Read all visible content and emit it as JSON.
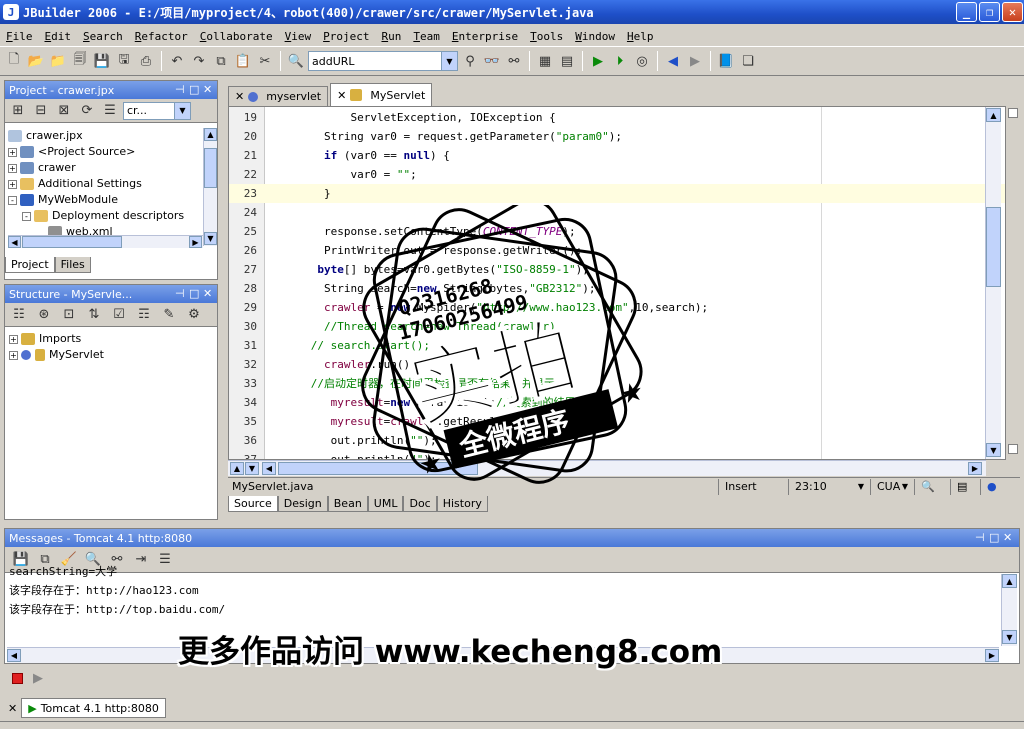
{
  "window": {
    "title": "JBuilder 2006 - E:/项目/myproject/4、robot(400)/crawer/src/crawer/MyServlet.java",
    "minimize_glyph": "_",
    "restore_glyph": "❐",
    "close_glyph": "✕"
  },
  "menu": [
    "File",
    "Edit",
    "Search",
    "Refactor",
    "Collaborate",
    "View",
    "Project",
    "Run",
    "Team",
    "Enterprise",
    "Tools",
    "Window",
    "Help"
  ],
  "toolbar": {
    "target_combo": "addURL"
  },
  "project_panel": {
    "title": "Project - crawer.jpx",
    "combo": "cr...",
    "tree": [
      {
        "label": "crawer.jpx",
        "indent": 0,
        "expander": "",
        "icon": "project-icon"
      },
      {
        "label": "<Project Source>",
        "indent": 1,
        "expander": "+",
        "icon": "package-icon"
      },
      {
        "label": "crawer",
        "indent": 1,
        "expander": "+",
        "icon": "package-icon"
      },
      {
        "label": "Additional Settings",
        "indent": 1,
        "expander": "+",
        "icon": "folder-icon"
      },
      {
        "label": "MyWebModule",
        "indent": 1,
        "expander": "-",
        "icon": "module-icon"
      },
      {
        "label": "Deployment descriptors",
        "indent": 2,
        "expander": "-",
        "icon": "folder-icon"
      },
      {
        "label": "web.xml",
        "indent": 3,
        "expander": "",
        "icon": "xml-icon"
      }
    ],
    "tabs": [
      "Project",
      "Files"
    ]
  },
  "structure_panel": {
    "title": "Structure - MyServle...",
    "tree": [
      {
        "label": "Imports",
        "expander": "+",
        "icon": "imports-icon"
      },
      {
        "label": "MyServlet",
        "expander": "+",
        "icon": "class-icon"
      }
    ]
  },
  "editor": {
    "tabs": [
      {
        "label": "myservlet",
        "active": false
      },
      {
        "label": "MyServlet",
        "active": true
      }
    ],
    "lines": [
      {
        "n": "19",
        "html": "            ServletException, IOException {",
        "hl": false
      },
      {
        "n": "20",
        "html": "        String var0 = request.getParameter(<span class='str'>\"param0\"</span>);",
        "hl": false
      },
      {
        "n": "21",
        "html": "        <span class='kw'>if</span> (var0 == <span class='kw'>null</span>) {",
        "hl": false
      },
      {
        "n": "22",
        "html": "            var0 = <span class='str'>\"\"</span>;",
        "hl": false
      },
      {
        "n": "23",
        "html": "        }",
        "hl": true
      },
      {
        "n": "24",
        "html": "",
        "hl": false
      },
      {
        "n": "25",
        "html": "        response.setContentType(<span class='cst'>CONTENT_TYPE</span>);",
        "hl": false
      },
      {
        "n": "26",
        "html": "        PrintWriter out = response.getWriter();",
        "hl": false
      },
      {
        "n": "27",
        "html": "       <span class='kw'>byte</span>[] bytes=var0.getBytes(<span class='str'>\"ISO-8859-1\"</span>);",
        "hl": false
      },
      {
        "n": "28",
        "html": "        String search=<span class='kw'>new</span> String(bytes,<span class='str'>\"GB2312\"</span>);",
        "hl": false
      },
      {
        "n": "29",
        "html": "        <span class='field'>crawler</span> = <span class='kw'>new</span> Myspider(<span class='str'>\"http://www.hao123.com\"</span>,10,search);",
        "hl": false
      },
      {
        "n": "30",
        "html": "        <span class='cmt'>//Thread search=new Thread(crawler)</span>",
        "hl": false
      },
      {
        "n": "31",
        "html": "      <span class='cmt'>// search.start();</span>",
        "hl": false
      },
      {
        "n": "32",
        "html": "        <span class='field'>crawler</span>.run();",
        "hl": false
      },
      {
        "n": "33",
        "html": "      <span class='cmt'>//启动定时器，在时间里检查是否有结果，并显示</span>",
        "hl": false
      },
      {
        "n": "34",
        "html": "         <span class='field'>myresult</span>=<span class='kw'>new</span> ArrayList<String>();<span class='cmt'>//搜索到的结果</span>",
        "hl": false
      },
      {
        "n": "35",
        "html": "         <span class='field'>myresult</span>=<span class='field'>crawler</span>.getResult();",
        "hl": false
      },
      {
        "n": "36",
        "html": "         out.println(<span class='str'>\"<html>\"</span>);",
        "hl": false
      },
      {
        "n": "37",
        "html": "         out.println(<span class='str'>\"<head><title>MyServlet</title></head>\"</span>);",
        "hl": false
      }
    ],
    "status_file": "MyServlet.java",
    "status_mode": "Insert",
    "status_pos": "23:10",
    "status_enc": "CUA",
    "bottom_tabs": [
      "Source",
      "Design",
      "Bean",
      "UML",
      "Doc",
      "History"
    ]
  },
  "messages_panel": {
    "title": "Messages - Tomcat 4.1 http:8080",
    "lines": [
      "searchString=大学",
      "该字段存在于：http://hao123.com",
      "该字段存在于：http://top.baidu.com/"
    ],
    "run_tab": "Tomcat 4.1 http:8080"
  },
  "watermark": {
    "qq1": "Q2316268",
    "qq2": "17060256499",
    "stamp_big": "实拍",
    "stamp_small": "全微程序",
    "footer": "更多作品访问 www.kecheng8.com"
  },
  "colors": {
    "title_bar": "#1e4fc8",
    "panel_head": "#4a78d8",
    "current_line": "#fffde0"
  }
}
